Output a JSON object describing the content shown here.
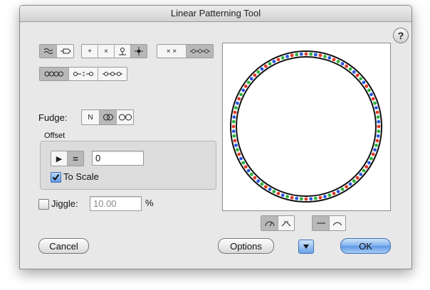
{
  "window": {
    "title": "Linear Patterning Tool"
  },
  "help": {
    "label": "?"
  },
  "toolbar": {
    "point_buttons": [
      "+",
      "×",
      "",
      ""
    ],
    "spacing_buttons": [
      "× ×",
      ""
    ]
  },
  "fudge": {
    "label": "Fudge:",
    "options": [
      "N",
      "",
      ""
    ]
  },
  "offset": {
    "label": "Offset",
    "mode_buttons": [
      "▶",
      "="
    ],
    "value": "0",
    "to_scale_label": "To Scale",
    "to_scale_checked": true
  },
  "jiggle": {
    "label": "Jiggle:",
    "value": "10.00",
    "unit": "%",
    "checked": false
  },
  "buttons": {
    "cancel": "Cancel",
    "options": "Options",
    "ok": "OK"
  },
  "colors": {
    "accent": "#5d98e5",
    "ring_red": "#e23a2a",
    "ring_green": "#2db33d",
    "ring_blue": "#2a58e2"
  }
}
